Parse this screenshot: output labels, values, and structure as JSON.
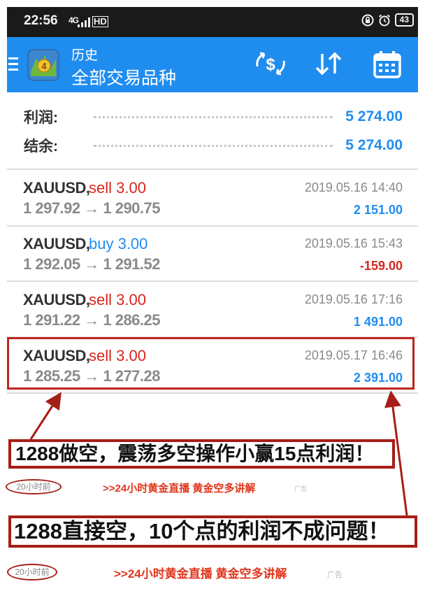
{
  "status_bar": {
    "time": "22:56",
    "network": "4G",
    "hd": "HD",
    "battery": "43"
  },
  "app_bar": {
    "title": "历史",
    "subtitle": "全部交易品种"
  },
  "summary": {
    "profit_label": "利润:",
    "profit_value": "5 274.00",
    "balance_label": "结余:",
    "balance_value": "5 274.00"
  },
  "trades": [
    {
      "symbol": "XAUUSD,",
      "action": "sell 3.00",
      "prices": "1 297.92 → 1 290.75",
      "date": "2019.05.16 14:40",
      "profit": "2 151.00"
    },
    {
      "symbol": "XAUUSD,",
      "action": "buy 3.00",
      "prices": "1 292.05 → 1 291.52",
      "date": "2019.05.16 15:43",
      "profit": "-159.00"
    },
    {
      "symbol": "XAUUSD,",
      "action": "sell 3.00",
      "prices": "1 291.22 → 1 286.25",
      "date": "2019.05.16 17:16",
      "profit": "1 491.00"
    },
    {
      "symbol": "XAUUSD,",
      "action": "sell 3.00",
      "prices": "1 285.25 → 1 277.28",
      "date": "2019.05.17 16:46",
      "profit": "2 391.00"
    }
  ],
  "annotations": {
    "banner1": "1288做空，震荡多空操作小赢15点利润！",
    "banner2": "1288直接空，10个点的利润不成问题！",
    "time1": "20小时前",
    "time2": "20小时前",
    "promo1": ">>24小时黄金直播 黄金空多讲解",
    "promo2": ">>24小时黄金直播 黄金空多讲解",
    "ad1": "广告",
    "ad2": "广告"
  },
  "colors": {
    "accent": "#1f8df0",
    "sell": "#d9251e",
    "annotation": "#a51e17"
  }
}
